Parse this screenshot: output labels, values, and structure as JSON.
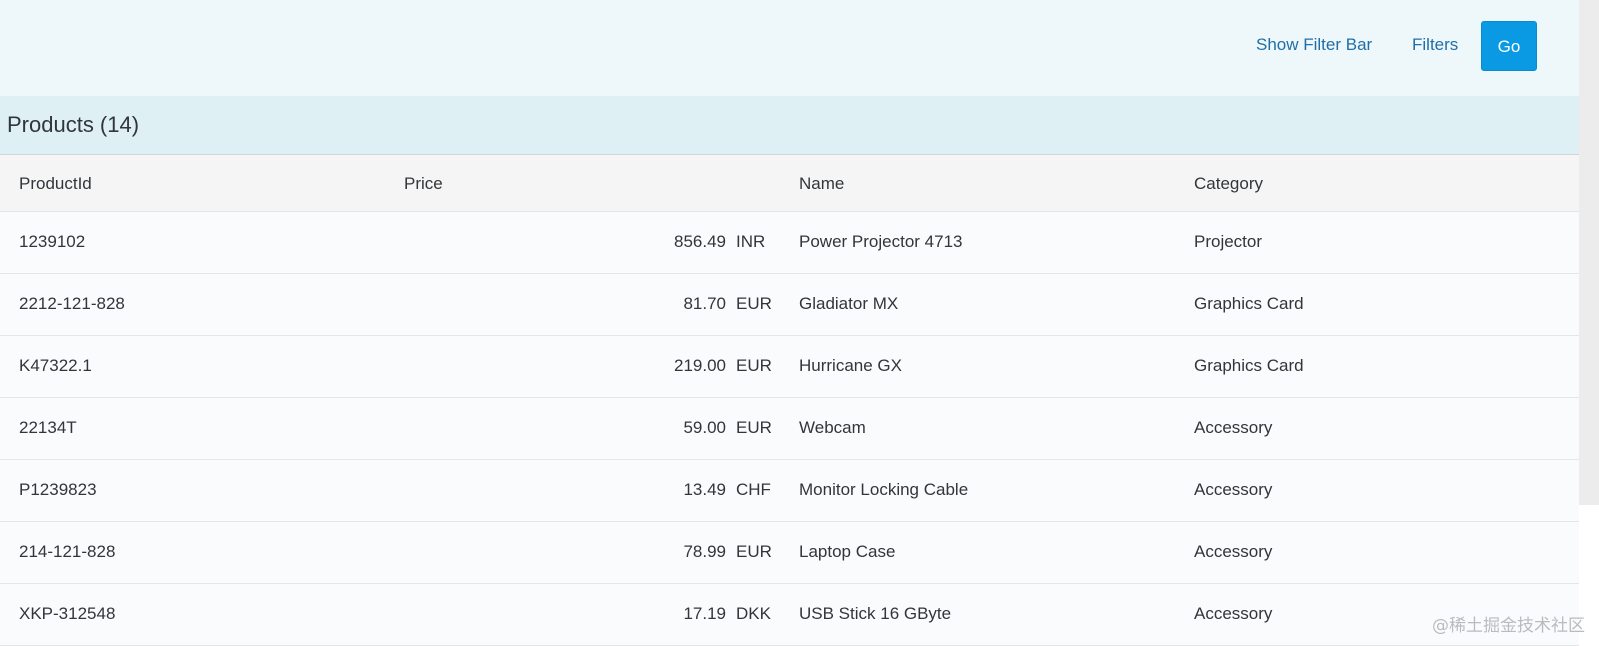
{
  "filterbar": {
    "show_filter_bar_label": "Show Filter Bar",
    "filters_label": "Filters",
    "go_label": "Go"
  },
  "table": {
    "title": "Products (14)",
    "columns": [
      "ProductId",
      "Price",
      "Name",
      "Category"
    ],
    "rows": [
      {
        "id": "1239102",
        "amount": "856.49",
        "currency": "INR",
        "name": "Power Projector 4713",
        "category": "Projector"
      },
      {
        "id": "2212-121-828",
        "amount": "81.70",
        "currency": "EUR",
        "name": "Gladiator MX",
        "category": "Graphics Card"
      },
      {
        "id": "K47322.1",
        "amount": "219.00",
        "currency": "EUR",
        "name": "Hurricane GX",
        "category": "Graphics Card"
      },
      {
        "id": "22134T",
        "amount": "59.00",
        "currency": "EUR",
        "name": "Webcam",
        "category": "Accessory"
      },
      {
        "id": "P1239823",
        "amount": "13.49",
        "currency": "CHF",
        "name": "Monitor Locking Cable",
        "category": "Accessory"
      },
      {
        "id": "214-121-828",
        "amount": "78.99",
        "currency": "EUR",
        "name": "Laptop Case",
        "category": "Accessory"
      },
      {
        "id": "XKP-312548",
        "amount": "17.19",
        "currency": "DKK",
        "name": "USB Stick 16 GByte",
        "category": "Accessory"
      }
    ]
  },
  "watermark": "@稀土掘金技术社区",
  "colors": {
    "accent": "#0a9ae3",
    "link": "#1f6fa8",
    "title_bar": "#dff0f4"
  }
}
